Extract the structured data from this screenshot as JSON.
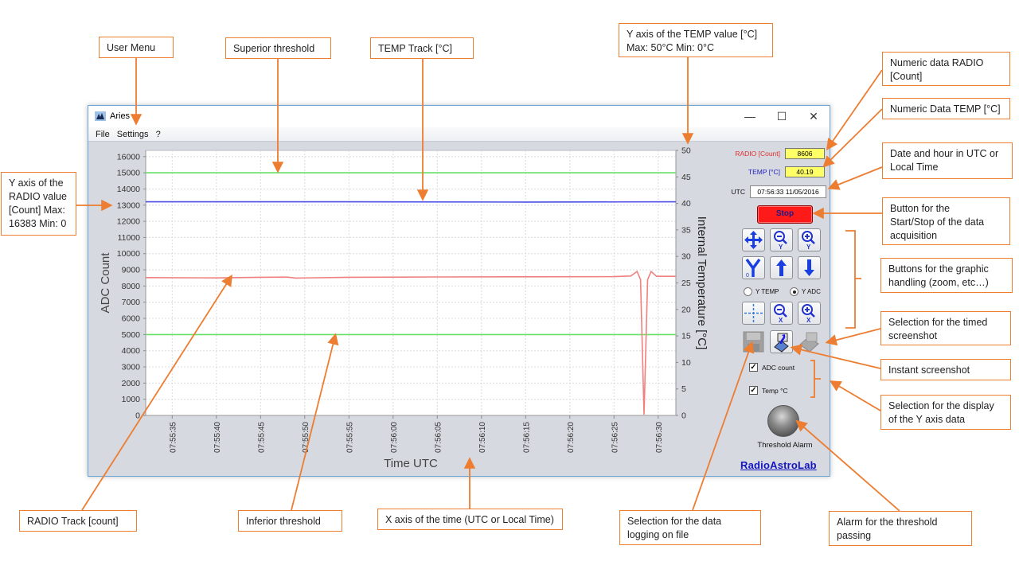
{
  "window": {
    "title": "Aries",
    "controls": {
      "minimize": "—",
      "maximize": "☐",
      "close": "✕"
    }
  },
  "menu": [
    "File",
    "Settings",
    "?"
  ],
  "chart_data": {
    "type": "line",
    "title": "",
    "xlabel": "Time UTC",
    "ylabel_left": "ADC Count",
    "ylabel_right": "Internal Temperature [°C]",
    "x_ticks": [
      "07:55:35",
      "07:55:40",
      "07:55:45",
      "07:55:50",
      "07:55:55",
      "07:56:00",
      "07:56:05",
      "07:56:10",
      "07:56:15",
      "07:56:20",
      "07:56:25",
      "07:56:30"
    ],
    "x_range_seconds": [
      -3,
      57
    ],
    "y_left_ticks": [
      0,
      1000,
      2000,
      3000,
      4000,
      5000,
      6000,
      7000,
      8000,
      9000,
      10000,
      11000,
      12000,
      13000,
      14000,
      15000,
      16000
    ],
    "y_left_range": [
      0,
      16383
    ],
    "y_right_ticks": [
      0,
      5,
      10,
      15,
      20,
      25,
      30,
      35,
      40,
      45,
      50
    ],
    "y_right_range": [
      0,
      50
    ],
    "grid": true,
    "series": [
      {
        "name": "Superior threshold",
        "axis": "left",
        "color": "#66e066",
        "values": [
          [
            -3,
            15000
          ],
          [
            57,
            15000
          ]
        ]
      },
      {
        "name": "Inferior threshold",
        "axis": "left",
        "color": "#66e066",
        "values": [
          [
            -3,
            5000
          ],
          [
            57,
            5000
          ]
        ]
      },
      {
        "name": "TEMP Track [°C]",
        "axis": "right",
        "color": "#4a4ae8",
        "values": [
          [
            -3,
            40.3
          ],
          [
            20,
            40.3
          ],
          [
            40,
            40.25
          ],
          [
            57,
            40.3
          ]
        ]
      },
      {
        "name": "RADIO Track [count]",
        "axis": "left",
        "color": "#f08080",
        "values": [
          [
            -3,
            8520
          ],
          [
            5,
            8500
          ],
          [
            10,
            8540
          ],
          [
            13,
            8550
          ],
          [
            14,
            8490
          ],
          [
            20,
            8540
          ],
          [
            30,
            8560
          ],
          [
            40,
            8570
          ],
          [
            50,
            8580
          ],
          [
            51.9,
            8620
          ],
          [
            52.6,
            8900
          ],
          [
            53.0,
            8400
          ],
          [
            53.4,
            50
          ],
          [
            53.8,
            8400
          ],
          [
            54.2,
            8900
          ],
          [
            54.8,
            8600
          ],
          [
            57,
            8600
          ]
        ]
      }
    ]
  },
  "panel": {
    "radio_label": "RADIO [Count]",
    "radio_value": "8606",
    "temp_label": "TEMP [°C]",
    "temp_value": "40.19",
    "utc_label": "UTC",
    "utc_value": "07:56:33   11/05/2016",
    "stop_label": "Stop",
    "radio_y_temp": "Y TEMP",
    "radio_y_adc": "Y ADC",
    "selected_axis": "Y ADC",
    "check_adc": "ADC count",
    "check_temp": "Temp °C",
    "alarm_label": "Threshold Alarm",
    "brand": "RadioAstroLab",
    "colors": {
      "radio_label": "#e03030",
      "temp_label": "#2020c0",
      "value_bg": "#ffff66",
      "stop_bg": "#ff1a1a"
    }
  },
  "callouts": {
    "user_menu": "User Menu",
    "superior_threshold": "Superior threshold",
    "temp_track": "TEMP Track  [°C]",
    "y_temp_axis": "Y axis of the TEMP value  [°C]\nMax: 50°C Min: 0°C",
    "numeric_radio": "Numeric data RADIO\n[Count]",
    "numeric_temp": "Numeric Data TEMP [°C]",
    "date_hour": "Date and hour in UTC or\nLocal Time",
    "start_stop": "Button for the\nStart/Stop of the data\nacquisition",
    "graphic_buttons": "Buttons for the graphic\nhandling  (zoom, etc…)",
    "timed_screenshot": "Selection for the timed\nscreenshot",
    "instant_screenshot": "Instant screenshot",
    "y_axis_display": "Selection for the display\nof the Y axis data",
    "y_radio_axis": "Y axis of the\nRADIO value\n[Count]  Max:\n16383 Min: 0",
    "radio_track": "RADIO Track [count]",
    "inferior_threshold": "Inferior threshold",
    "x_axis": "X axis of the time (UTC or Local Time)",
    "data_logging": "Selection for the data\nlogging on file",
    "alarm": "Alarm for the threshold\npassing"
  }
}
